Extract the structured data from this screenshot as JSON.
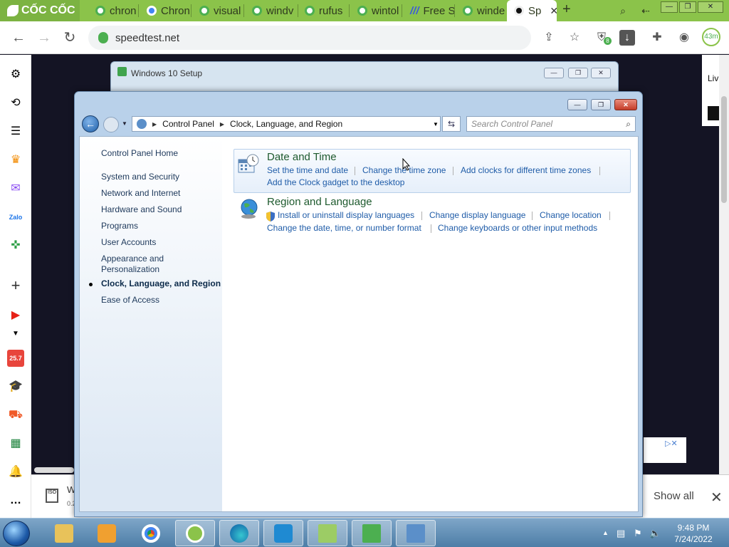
{
  "browser": {
    "brand": "CỐC CỐC",
    "tabs": [
      {
        "label": "chron",
        "icon": "coccoc-icon"
      },
      {
        "label": "Chron",
        "icon": "chrome-icon"
      },
      {
        "label": "visual",
        "icon": "coccoc-icon"
      },
      {
        "label": "windv",
        "icon": "coccoc-icon"
      },
      {
        "label": "rufus",
        "icon": "coccoc-icon"
      },
      {
        "label": "wintol",
        "icon": "coccoc-icon"
      },
      {
        "label": "Free S",
        "icon": "freeS-icon",
        "icon_text": "///"
      },
      {
        "label": "winde",
        "icon": "coccoc-icon"
      },
      {
        "label": "Sp",
        "icon": "speedtest-icon"
      }
    ],
    "url": "speedtest.net",
    "profile_badge": "43m",
    "extension_badge": "8"
  },
  "page_content": {
    "right_text": "Liv",
    "show_all": "Show all",
    "download_title": "W",
    "download_sub": "0.2",
    "download_icon_text": "ISO"
  },
  "side_panel": {
    "shopping_badge": "25.7"
  },
  "setup_window": {
    "title": "Windows 10 Setup"
  },
  "control_panel": {
    "breadcrumb": [
      "Control Panel",
      "Clock, Language, and Region"
    ],
    "search_placeholder": "Search Control Panel",
    "nav": {
      "home": "Control Panel Home",
      "items": [
        "System and Security",
        "Network and Internet",
        "Hardware and Sound",
        "Programs",
        "User Accounts",
        "Appearance and Personalization",
        "Clock, Language, and Region",
        "Ease of Access"
      ],
      "current": "Clock, Language, and Region"
    },
    "date_time": {
      "title": "Date and Time",
      "links": [
        "Set the time and date",
        "Change the time zone",
        "Add clocks for different time zones",
        "Add the Clock gadget to the desktop"
      ]
    },
    "region_language": {
      "title": "Region and Language",
      "links": [
        "Install or uninstall display languages",
        "Change display language",
        "Change location",
        "Change the date, time, or number format",
        "Change keyboards or other input methods"
      ]
    }
  },
  "taskbar": {
    "time": "9:48 PM",
    "date": "7/24/2022"
  },
  "colors": {
    "browser_green": "#8bc34a",
    "link_blue": "#1f5ca8",
    "category_green": "#1e5a2e",
    "taskbar_blue": "#4d7ea7"
  }
}
